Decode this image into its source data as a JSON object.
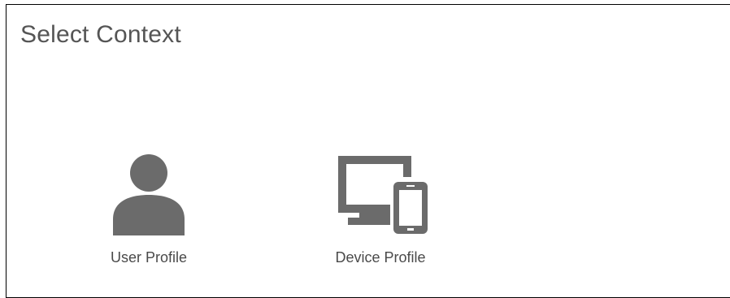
{
  "dialog": {
    "title": "Select Context"
  },
  "options": [
    {
      "label": "User Profile",
      "icon": "user-icon"
    },
    {
      "label": "Device Profile",
      "icon": "devices-icon"
    }
  ],
  "colors": {
    "icon": "#6b6b6b",
    "title_text": "#555555",
    "label_text": "#4a4a4a",
    "border": "#000000"
  }
}
